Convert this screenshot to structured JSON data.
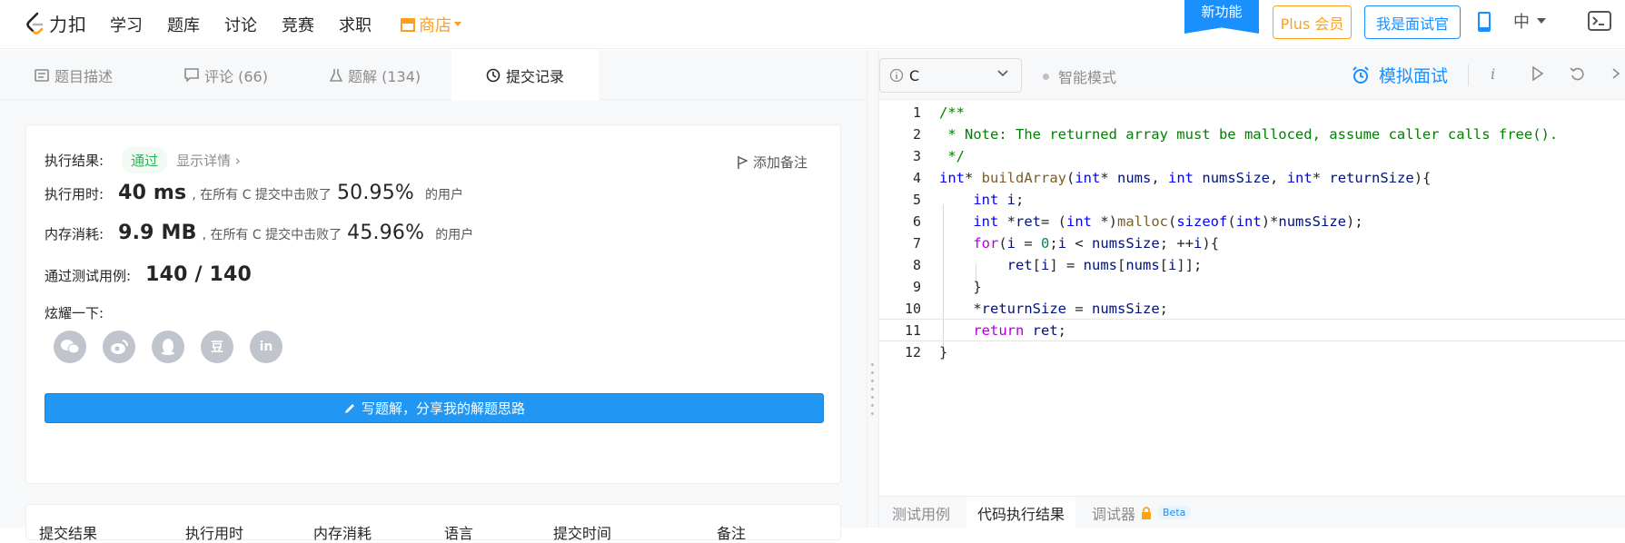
{
  "nav": {
    "logo": "力扣",
    "items": [
      "学习",
      "题库",
      "讨论",
      "竞赛",
      "求职"
    ],
    "shop": "商店",
    "new_feature": "新功能",
    "plus": "Plus 会员",
    "interviewer": "我是面试官",
    "lang": "中"
  },
  "tabs": [
    {
      "label": "题目描述"
    },
    {
      "label": "评论 (66)"
    },
    {
      "label": "题解 (134)"
    },
    {
      "label": "提交记录"
    }
  ],
  "result": {
    "label": "执行结果:",
    "status": "通过",
    "detail": "显示详情 ›",
    "add_note": "添加备注",
    "runtime_label": "执行用时:",
    "runtime": "40 ms",
    "runtime_mid": ", 在所有 C 提交中击败了",
    "runtime_pct": "50.95%",
    "users": "的用户",
    "mem_label": "内存消耗:",
    "mem": "9.9 MB",
    "mem_mid": ", 在所有 C 提交中击败了",
    "mem_pct": "45.96%",
    "tests_label": "通过测试用例:",
    "tests": "140 / 140",
    "share_label": "炫耀一下:",
    "share_icons": [
      "wechat-icon",
      "weibo-icon",
      "qq-icon",
      "douban-icon",
      "linkedin-icon"
    ],
    "douban_glyph": "豆",
    "linkedin_glyph": "in",
    "write_button": "写题解，分享我的解题思路"
  },
  "table_headers": [
    "提交结果",
    "执行用时",
    "内存消耗",
    "语言",
    "提交时间",
    "备注"
  ],
  "editor": {
    "language": "C",
    "smart_mode": "智能模式",
    "mock_interview": "模拟面试",
    "lines": [
      "/**",
      " * Note: The returned array must be malloced, assume caller calls free().",
      " */",
      "int* buildArray(int* nums, int numsSize, int* returnSize){",
      "    int i;",
      "    int *ret= (int *)malloc(sizeof(int)*numsSize);",
      "    for(i = 0;i < numsSize; ++i){",
      "        ret[i] = nums[nums[i]];",
      "    }",
      "    *returnSize = numsSize;",
      "    return ret;",
      "}"
    ],
    "current_line": 11
  },
  "bottom_tabs": [
    {
      "label": "测试用例"
    },
    {
      "label": "代码执行结果"
    },
    {
      "label": "调试器"
    }
  ],
  "beta": "Beta",
  "colors": {
    "accent": "#1a90ff",
    "pass": "#2db55d",
    "shop": "#ff9d1a"
  }
}
